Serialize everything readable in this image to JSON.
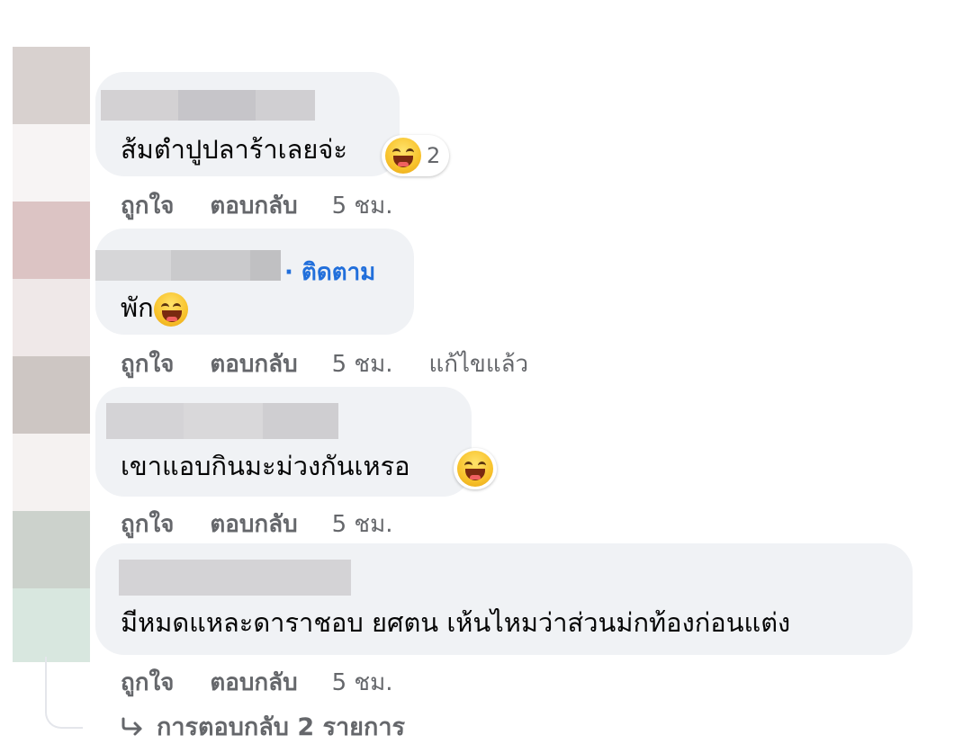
{
  "comments": [
    {
      "text": "ส้มตำปูปลาร้าเลยจ่ะ",
      "reaction": "laughing-emoji",
      "reaction_count": "2",
      "actions": {
        "like": "ถูกใจ",
        "reply": "ตอบกลับ",
        "time": "5 ชม."
      }
    },
    {
      "text": "พัก",
      "follow": "· ติดตาม",
      "inline_emoji": "laughing-emoji",
      "actions": {
        "like": "ถูกใจ",
        "reply": "ตอบกลับ",
        "time": "5 ชม.",
        "edited": "แก้ไขแล้ว"
      }
    },
    {
      "text": "เขาแอบกินมะม่วงกันเหรอ",
      "reaction": "laughing-emoji",
      "actions": {
        "like": "ถูกใจ",
        "reply": "ตอบกลับ",
        "time": "5 ชม."
      }
    },
    {
      "text": "มีหมดแหละดาราชอบ ยศตน เห้นไหมว่าส่วนม่กท้องก่อนแต่ง",
      "actions": {
        "like": "ถูกใจ",
        "reply": "ตอบกลับ",
        "time": "5 ชม."
      }
    }
  ],
  "view_replies": {
    "icon": "reply-arrow-icon",
    "label": "การตอบกลับ 2 รายการ"
  },
  "colors": {
    "bubble": "#f0f2f5",
    "meta_text": "#65676b",
    "follow_link": "#216fdb"
  }
}
